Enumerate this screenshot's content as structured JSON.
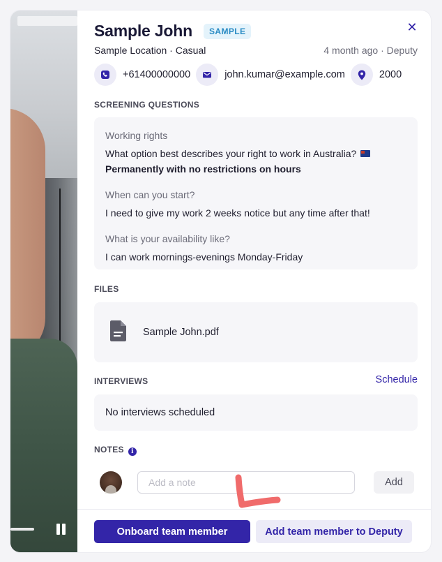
{
  "candidate": {
    "name": "Sample John",
    "badge": "SAMPLE",
    "subtitle": "Sample Location · Casual",
    "meta": "4 month ago · Deputy",
    "phone": "+61400000000",
    "email": "john.kumar@example.com",
    "postcode": "2000"
  },
  "icons": {
    "close": "close-icon",
    "phone": "phone-icon",
    "email": "email-icon",
    "location": "location-pin-icon",
    "file": "document-icon",
    "info": "info-icon",
    "pause": "pause-icon"
  },
  "screening": {
    "label": "SCREENING QUESTIONS",
    "questions": [
      {
        "title": "Working rights",
        "question": "What option best describes your right to work in Australia?",
        "answer": "Permanently with no restrictions on hours"
      },
      {
        "title": "When can you start?",
        "answer": "I need to give my work 2 weeks notice but any time after that!"
      },
      {
        "title": "What is your availability like?",
        "answer": "I can work mornings-evenings Monday-Friday"
      }
    ]
  },
  "files": {
    "label": "FILES",
    "items": [
      {
        "name": "Sample John.pdf"
      }
    ]
  },
  "interviews": {
    "label": "INTERVIEWS",
    "schedule_label": "Schedule",
    "empty_text": "No interviews scheduled"
  },
  "notes": {
    "label": "NOTES",
    "placeholder": "Add a note",
    "add_label": "Add"
  },
  "actions": {
    "primary": "Onboard team member",
    "secondary": "Add team member to Deputy"
  },
  "colors": {
    "accent": "#3325a8",
    "badge_bg": "#e4f3fb",
    "badge_text": "#2b8cc4",
    "annotation": "#f06b6b"
  }
}
